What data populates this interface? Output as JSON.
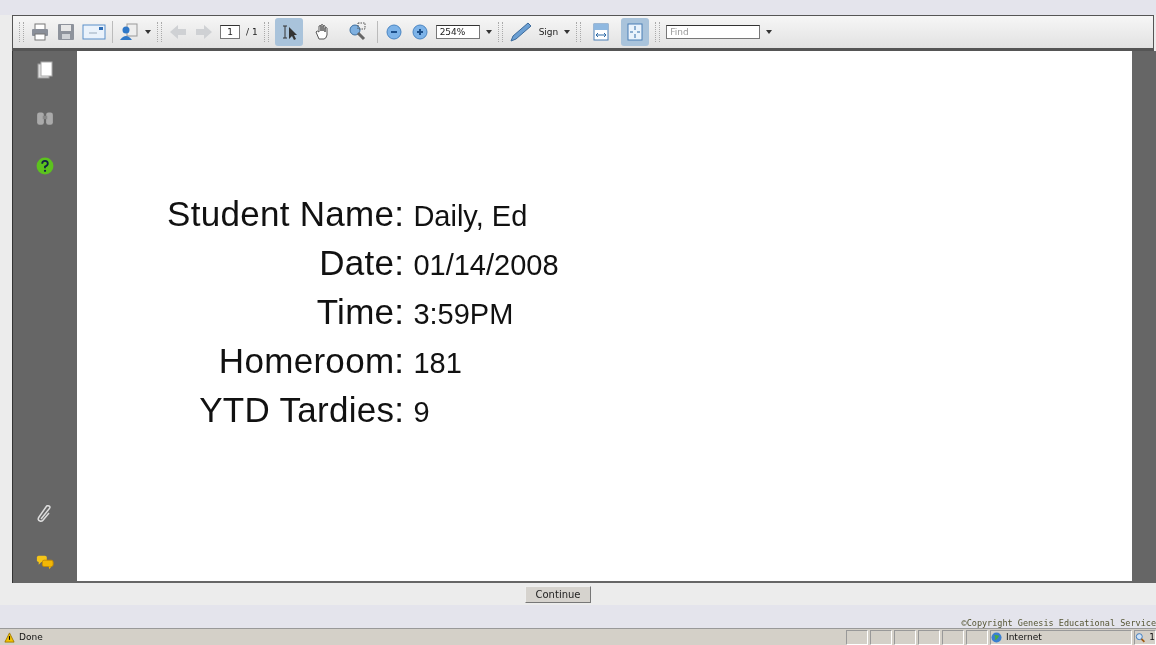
{
  "toolbar": {
    "page_field": "1",
    "page_total": "/ 1",
    "tools": [
      {
        "selected": true
      },
      {
        "selected": false
      },
      {
        "selected": false
      }
    ],
    "zoom_field": "254%",
    "sign_label": "Sign",
    "view_modes": [
      {
        "selected": false
      },
      {
        "selected": true
      }
    ],
    "find": {
      "placeholder": "Find"
    }
  },
  "document": {
    "fields": [
      {
        "label": "Student Name:",
        "value": "Daily, Ed"
      },
      {
        "label": "Date:",
        "value": "01/14/2008"
      },
      {
        "label": "Time:",
        "value": "3:59PM"
      },
      {
        "label": "Homeroom:",
        "value": "181"
      },
      {
        "label": "YTD Tardies:",
        "value": "9"
      }
    ]
  },
  "continue_button": "Continue",
  "copyright": "©Copyright Genesis Educational Service",
  "status_bar": {
    "status": "Done",
    "zone": "Internet",
    "zoom": "1"
  }
}
